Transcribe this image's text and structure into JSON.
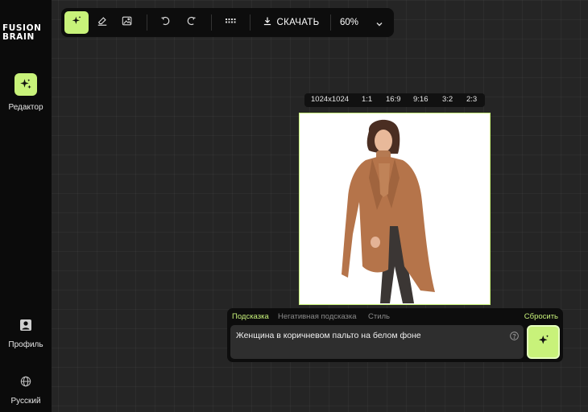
{
  "sidebar": {
    "logo_line1": "FUSION",
    "logo_line2": "BRAIN",
    "editor_label": "Редактор",
    "profile_label": "Профиль",
    "language_label": "Русский",
    "icons": [
      "sparkle-icon",
      "person-icon",
      "globe-icon"
    ]
  },
  "toolbar": {
    "download_label": "СКАЧАТЬ",
    "zoom_label": "60%",
    "icons": [
      "sparkle-icon",
      "eraser-icon",
      "image-edit-icon",
      "undo-icon",
      "redo-icon",
      "keyboard-icon",
      "download-icon",
      "chevron-down-icon"
    ]
  },
  "ratios": [
    "1024x1024",
    "1:1",
    "16:9",
    "9:16",
    "3:2",
    "2:3"
  ],
  "prompt": {
    "tabs": [
      "Подсказка",
      "Негативная подсказка",
      "Стиль"
    ],
    "reset_label": "Сбросить",
    "text": "Женщина в коричневом пальто на белом фоне"
  },
  "colors": {
    "accent": "#c8f27a",
    "background": "#252525",
    "panel": "#0d0d0d"
  }
}
